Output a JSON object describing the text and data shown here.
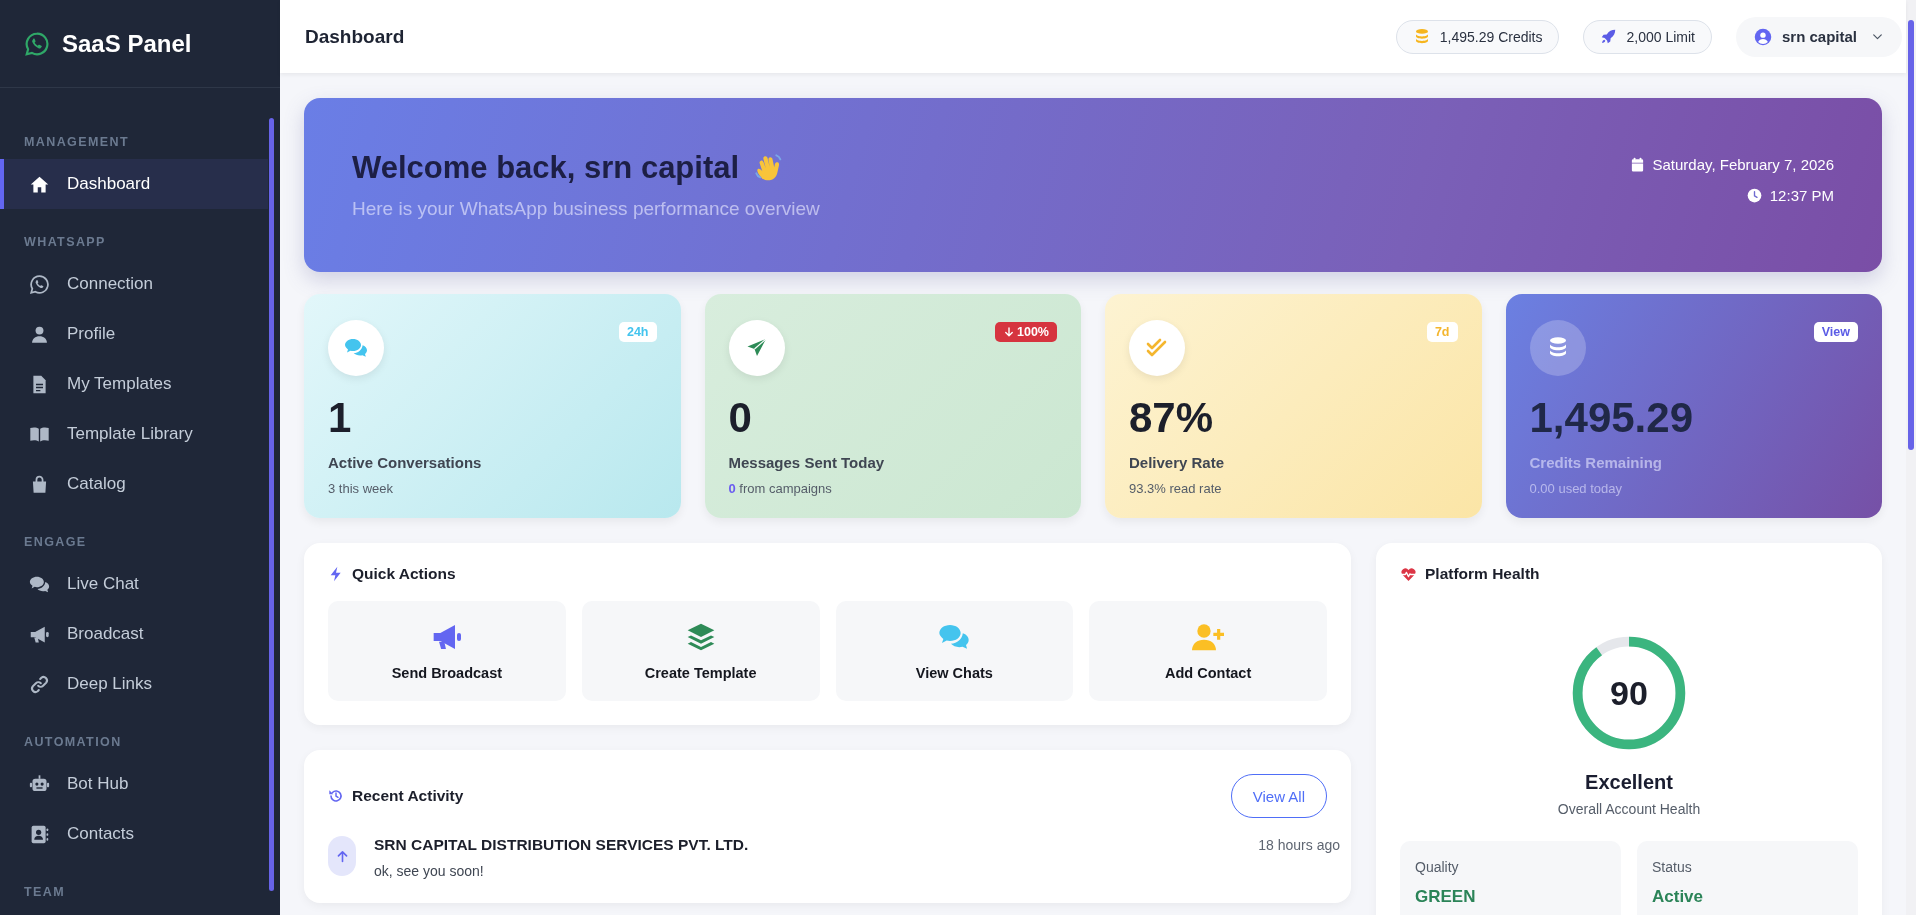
{
  "sidebar": {
    "brand": "SaaS Panel",
    "sections": [
      {
        "label": "MANAGEMENT",
        "items": [
          {
            "label": "Dashboard",
            "kind": "home",
            "selected": true
          }
        ]
      },
      {
        "label": "WHATSAPP",
        "items": [
          {
            "label": "Connection",
            "kind": "whatsapp",
            "selected": false
          },
          {
            "label": "Profile",
            "kind": "user",
            "selected": false
          },
          {
            "label": "My Templates",
            "kind": "file",
            "selected": false
          },
          {
            "label": "Template Library",
            "kind": "book",
            "selected": false
          },
          {
            "label": "Catalog",
            "kind": "bag",
            "selected": false
          }
        ]
      },
      {
        "label": "ENGAGE",
        "items": [
          {
            "label": "Live Chat",
            "kind": "chats",
            "selected": false
          },
          {
            "label": "Broadcast",
            "kind": "megaphone",
            "selected": false
          },
          {
            "label": "Deep Links",
            "kind": "link",
            "selected": false
          }
        ]
      },
      {
        "label": "AUTOMATION",
        "items": [
          {
            "label": "Bot Hub",
            "kind": "robot",
            "selected": false
          },
          {
            "label": "Contacts",
            "kind": "contact",
            "selected": false
          }
        ]
      },
      {
        "label": "TEAM"
      }
    ]
  },
  "header": {
    "title": "Dashboard",
    "credits": "1,495.29 Credits",
    "limit": "2,000 Limit",
    "user": "srn capital"
  },
  "banner": {
    "title": "Welcome back, srn capital",
    "subtitle": "Here is your WhatsApp business performance overview",
    "date": "Saturday, February 7, 2026",
    "time": "12:37 PM"
  },
  "stats": [
    {
      "kind": "conversations",
      "value": "1",
      "label": "Active Conversations",
      "sub": "3 this week",
      "badge": {
        "text": "24h",
        "kind": "period"
      }
    },
    {
      "kind": "messages",
      "value": "0",
      "label": "Messages Sent Today",
      "sub": "**0** from campaigns",
      "badge": {
        "text": "100%",
        "kind": "down"
      }
    },
    {
      "kind": "delivery",
      "value": "87%",
      "label": "Delivery Rate",
      "sub": "93.3% read rate",
      "badge": {
        "text": "7d",
        "kind": "period"
      }
    },
    {
      "kind": "credits",
      "value": "1,495.29",
      "label": "Credits Remaining",
      "sub": "0.00 used today",
      "badge": {
        "text": "View",
        "kind": "link"
      }
    }
  ],
  "quick_actions": {
    "title": "Quick Actions",
    "actions": [
      {
        "label": "Send Broadcast",
        "kind": "megaphone"
      },
      {
        "label": "Create Template",
        "kind": "layers"
      },
      {
        "label": "View Chats",
        "kind": "chats"
      },
      {
        "label": "Add Contact",
        "kind": "user-plus"
      }
    ]
  },
  "recent_activity": {
    "title": "Recent Activity",
    "button": "View All",
    "items": [
      {
        "name": "SRN CAPITAL DISTRIBUTION SERVICES PVT. LTD.",
        "message": "ok, see you soon!",
        "time": "18 hours ago",
        "kind": "outgoing"
      }
    ]
  },
  "health": {
    "title": "Platform Health",
    "score": "90",
    "level": 0.9,
    "rating": "Excellent",
    "caption": "Overall Account Health",
    "metrics": [
      {
        "label": "Quality",
        "value": "GREEN"
      },
      {
        "label": "Status",
        "value": "Active"
      }
    ]
  }
}
